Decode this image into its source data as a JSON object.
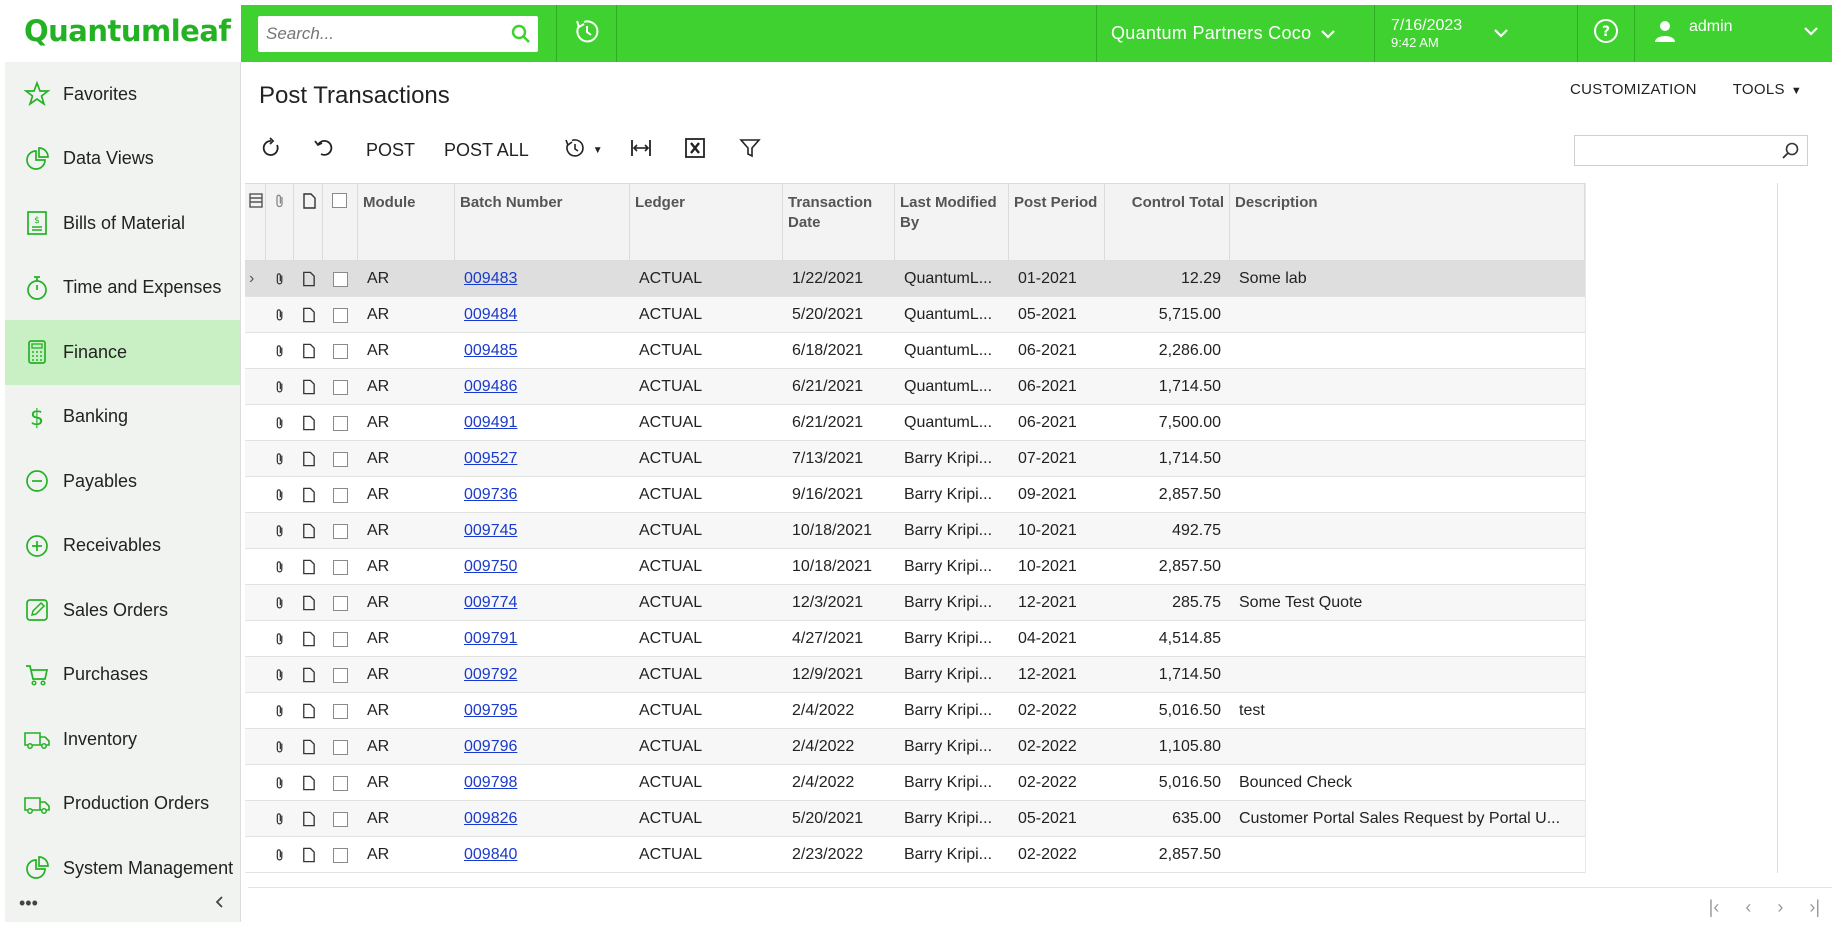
{
  "brand": {
    "logo_text": "Quantumleaf",
    "color": "#3ed12f"
  },
  "search": {
    "placeholder": "Search..."
  },
  "header": {
    "company": "Quantum Partners Coco",
    "date": "7/16/2023",
    "time": "9:42 AM",
    "user": "admin"
  },
  "sidebar": {
    "items": [
      {
        "label": "Favorites",
        "icon": "star-icon"
      },
      {
        "label": "Data Views",
        "icon": "pie-chart-icon"
      },
      {
        "label": "Bills of Material",
        "icon": "invoice-icon"
      },
      {
        "label": "Time and Expenses",
        "icon": "stopwatch-icon"
      },
      {
        "label": "Finance",
        "icon": "calculator-icon",
        "active": true
      },
      {
        "label": "Banking",
        "icon": "dollar-icon"
      },
      {
        "label": "Payables",
        "icon": "minus-circle-icon"
      },
      {
        "label": "Receivables",
        "icon": "plus-circle-icon"
      },
      {
        "label": "Sales Orders",
        "icon": "pencil-square-icon"
      },
      {
        "label": "Purchases",
        "icon": "cart-icon"
      },
      {
        "label": "Inventory",
        "icon": "truck-icon"
      },
      {
        "label": "Production Orders",
        "icon": "truck-icon"
      },
      {
        "label": "System Management",
        "icon": "pie-chart-icon"
      }
    ]
  },
  "page": {
    "title": "Post Transactions",
    "customization": "CUSTOMIZATION",
    "tools": "TOOLS"
  },
  "toolbar": {
    "post": "POST",
    "post_all": "POST ALL"
  },
  "grid": {
    "columns": {
      "module": "Module",
      "batch": "Batch Number",
      "ledger": "Ledger",
      "tdate": "Transaction Date",
      "lastmod": "Last Modified By",
      "period": "Post Period",
      "total": "Control Total",
      "desc": "Description"
    },
    "rows": [
      {
        "module": "AR",
        "batch": "009483",
        "ledger": "ACTUAL",
        "tdate": "1/22/2021",
        "lastmod": "QuantumL...",
        "period": "01-2021",
        "total": "12.29",
        "desc": "Some lab"
      },
      {
        "module": "AR",
        "batch": "009484",
        "ledger": "ACTUAL",
        "tdate": "5/20/2021",
        "lastmod": "QuantumL...",
        "period": "05-2021",
        "total": "5,715.00",
        "desc": ""
      },
      {
        "module": "AR",
        "batch": "009485",
        "ledger": "ACTUAL",
        "tdate": "6/18/2021",
        "lastmod": "QuantumL...",
        "period": "06-2021",
        "total": "2,286.00",
        "desc": ""
      },
      {
        "module": "AR",
        "batch": "009486",
        "ledger": "ACTUAL",
        "tdate": "6/21/2021",
        "lastmod": "QuantumL...",
        "period": "06-2021",
        "total": "1,714.50",
        "desc": ""
      },
      {
        "module": "AR",
        "batch": "009491",
        "ledger": "ACTUAL",
        "tdate": "6/21/2021",
        "lastmod": "QuantumL...",
        "period": "06-2021",
        "total": "7,500.00",
        "desc": ""
      },
      {
        "module": "AR",
        "batch": "009527",
        "ledger": "ACTUAL",
        "tdate": "7/13/2021",
        "lastmod": "Barry Kripi...",
        "period": "07-2021",
        "total": "1,714.50",
        "desc": ""
      },
      {
        "module": "AR",
        "batch": "009736",
        "ledger": "ACTUAL",
        "tdate": "9/16/2021",
        "lastmod": "Barry Kripi...",
        "period": "09-2021",
        "total": "2,857.50",
        "desc": ""
      },
      {
        "module": "AR",
        "batch": "009745",
        "ledger": "ACTUAL",
        "tdate": "10/18/2021",
        "lastmod": "Barry Kripi...",
        "period": "10-2021",
        "total": "492.75",
        "desc": ""
      },
      {
        "module": "AR",
        "batch": "009750",
        "ledger": "ACTUAL",
        "tdate": "10/18/2021",
        "lastmod": "Barry Kripi...",
        "period": "10-2021",
        "total": "2,857.50",
        "desc": ""
      },
      {
        "module": "AR",
        "batch": "009774",
        "ledger": "ACTUAL",
        "tdate": "12/3/2021",
        "lastmod": "Barry Kripi...",
        "period": "12-2021",
        "total": "285.75",
        "desc": "Some Test Quote"
      },
      {
        "module": "AR",
        "batch": "009791",
        "ledger": "ACTUAL",
        "tdate": "4/27/2021",
        "lastmod": "Barry Kripi...",
        "period": "04-2021",
        "total": "4,514.85",
        "desc": ""
      },
      {
        "module": "AR",
        "batch": "009792",
        "ledger": "ACTUAL",
        "tdate": "12/9/2021",
        "lastmod": "Barry Kripi...",
        "period": "12-2021",
        "total": "1,714.50",
        "desc": ""
      },
      {
        "module": "AR",
        "batch": "009795",
        "ledger": "ACTUAL",
        "tdate": "2/4/2022",
        "lastmod": "Barry Kripi...",
        "period": "02-2022",
        "total": "5,016.50",
        "desc": "test"
      },
      {
        "module": "AR",
        "batch": "009796",
        "ledger": "ACTUAL",
        "tdate": "2/4/2022",
        "lastmod": "Barry Kripi...",
        "period": "02-2022",
        "total": "1,105.80",
        "desc": ""
      },
      {
        "module": "AR",
        "batch": "009798",
        "ledger": "ACTUAL",
        "tdate": "2/4/2022",
        "lastmod": "Barry Kripi...",
        "period": "02-2022",
        "total": "5,016.50",
        "desc": "Bounced Check"
      },
      {
        "module": "AR",
        "batch": "009826",
        "ledger": "ACTUAL",
        "tdate": "5/20/2021",
        "lastmod": "Barry Kripi...",
        "period": "05-2021",
        "total": "635.00",
        "desc": "Customer Portal Sales Request by Portal U..."
      },
      {
        "module": "AR",
        "batch": "009840",
        "ledger": "ACTUAL",
        "tdate": "2/23/2022",
        "lastmod": "Barry Kripi...",
        "period": "02-2022",
        "total": "2,857.50",
        "desc": ""
      }
    ]
  }
}
